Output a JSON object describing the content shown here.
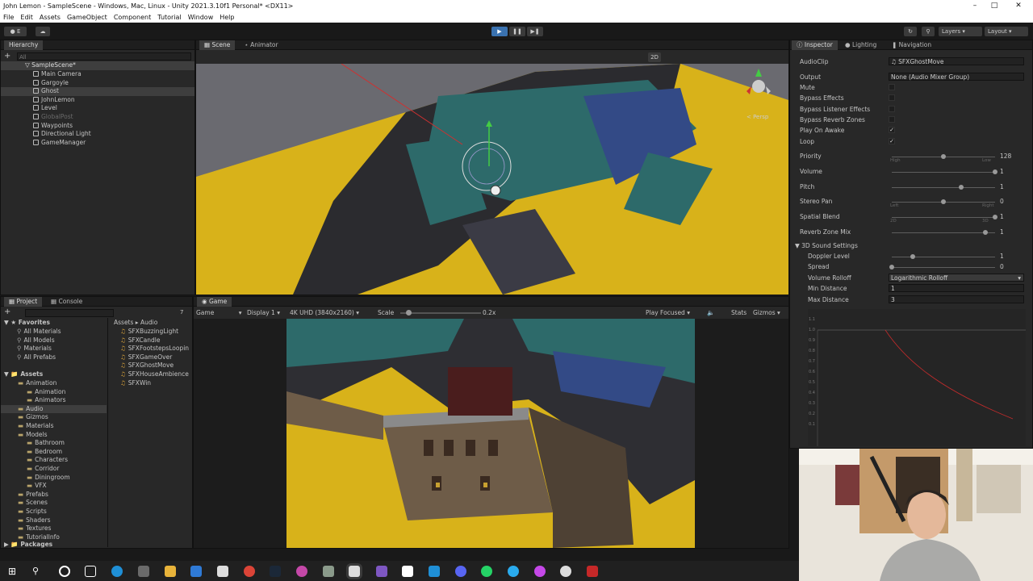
{
  "window": {
    "title": "John Lemon - SampleScene - Windows, Mac, Linux - Unity 2021.3.10f1 Personal* <DX11>"
  },
  "menu": [
    "File",
    "Edit",
    "Assets",
    "GameObject",
    "Component",
    "Tutorial",
    "Window",
    "Help"
  ],
  "toolbar": {
    "layers": "Layers",
    "layout": "Layout"
  },
  "hierarchy": {
    "tab": "Hierarchy",
    "search_placeholder": "All",
    "scene": "SampleScene*",
    "items": [
      "Main Camera",
      "Gargoyle",
      "Ghost",
      "JohnLemon",
      "Level",
      "GlobalPost",
      "Waypoints",
      "Directional Light",
      "GameManager"
    ]
  },
  "scene_view": {
    "tabs": [
      "Scene",
      "Animator"
    ],
    "mode_2d": "2D",
    "persp": "< Persp"
  },
  "game_view": {
    "tab": "Game",
    "mode": "Game",
    "display": "Display 1",
    "resolution": "4K UHD (3840x2160)",
    "scale_label": "Scale",
    "scale_value": "0.2x",
    "scale_fraction": 0.1,
    "play_mode": "Play Focused",
    "stats": "Stats",
    "gizmos": "Gizmos"
  },
  "project": {
    "tabs": [
      "Project",
      "Console"
    ],
    "hidden_count": "7",
    "favorites_label": "Favorites",
    "favorites": [
      "All Materials",
      "All Models",
      "Materials",
      "All Prefabs"
    ],
    "assets_label": "Assets",
    "assets_tree": [
      {
        "label": "Animation",
        "indent": 1
      },
      {
        "label": "Animation",
        "indent": 2
      },
      {
        "label": "Animators",
        "indent": 2
      },
      {
        "label": "Audio",
        "indent": 1
      },
      {
        "label": "Gizmos",
        "indent": 1
      },
      {
        "label": "Materials",
        "indent": 1
      },
      {
        "label": "Models",
        "indent": 1
      },
      {
        "label": "Bathroom",
        "indent": 2
      },
      {
        "label": "Bedroom",
        "indent": 2
      },
      {
        "label": "Characters",
        "indent": 2
      },
      {
        "label": "Corridor",
        "indent": 2
      },
      {
        "label": "Diningroom",
        "indent": 2
      },
      {
        "label": "VFX",
        "indent": 2
      },
      {
        "label": "Prefabs",
        "indent": 1
      },
      {
        "label": "Scenes",
        "indent": 1
      },
      {
        "label": "Scripts",
        "indent": 1
      },
      {
        "label": "Shaders",
        "indent": 1
      },
      {
        "label": "Textures",
        "indent": 1
      },
      {
        "label": "TutorialInfo",
        "indent": 1
      }
    ],
    "packages_label": "Packages",
    "breadcrumb": [
      "Assets",
      "Audio"
    ],
    "files": [
      "SFXBuzzingLight",
      "SFXCandle",
      "SFXFootstepsLoopin",
      "SFXGameOver",
      "SFXGhostMove",
      "SFXHouseAmbience",
      "SFXWin"
    ]
  },
  "inspector": {
    "tabs": [
      "Inspector",
      "Lighting",
      "Navigation"
    ],
    "audio_clip_label": "AudioClip",
    "audio_clip": "SFXGhostMove",
    "output_label": "Output",
    "output": "None (Audio Mixer Group)",
    "toggles": [
      {
        "label": "Mute",
        "checked": false
      },
      {
        "label": "Bypass Effects",
        "checked": false
      },
      {
        "label": "Bypass Listener Effects",
        "checked": false
      },
      {
        "label": "Bypass Reverb Zones",
        "checked": false
      },
      {
        "label": "Play On Awake",
        "checked": true
      },
      {
        "label": "Loop",
        "checked": true
      }
    ],
    "sliders": [
      {
        "label": "Priority",
        "value": "128",
        "fraction": 0.5,
        "min_label": "High",
        "max_label": "Low"
      },
      {
        "label": "Volume",
        "value": "1",
        "fraction": 1.0
      },
      {
        "label": "Pitch",
        "value": "1",
        "fraction": 0.67
      },
      {
        "label": "Stereo Pan",
        "value": "0",
        "fraction": 0.5,
        "min_label": "Left",
        "max_label": "Right"
      },
      {
        "label": "Spatial Blend",
        "value": "1",
        "fraction": 1.0,
        "min_label": "2D",
        "max_label": "3D"
      },
      {
        "label": "Reverb Zone Mix",
        "value": "1",
        "fraction": 0.91
      }
    ],
    "sound3d_label": "3D Sound Settings",
    "doppler": {
      "label": "Doppler Level",
      "value": "1",
      "fraction": 0.2
    },
    "spread": {
      "label": "Spread",
      "value": "0",
      "fraction": 0.0
    },
    "rolloff_label": "Volume Rolloff",
    "rolloff": "Logarithmic Rolloff",
    "min_distance_label": "Min Distance",
    "min_distance": "1",
    "max_distance_label": "Max Distance",
    "max_distance": "3",
    "graph_ticks": [
      "1.1",
      "1.0",
      "0.9",
      "0.8",
      "0.7",
      "0.6",
      "0.5",
      "0.4",
      "0.3",
      "0.2",
      "0.1"
    ]
  },
  "colors": {
    "accent": "#3a72b0",
    "sand": "#d8b21a",
    "wall": "#2d6a6a",
    "curve": "#c22b2b"
  }
}
